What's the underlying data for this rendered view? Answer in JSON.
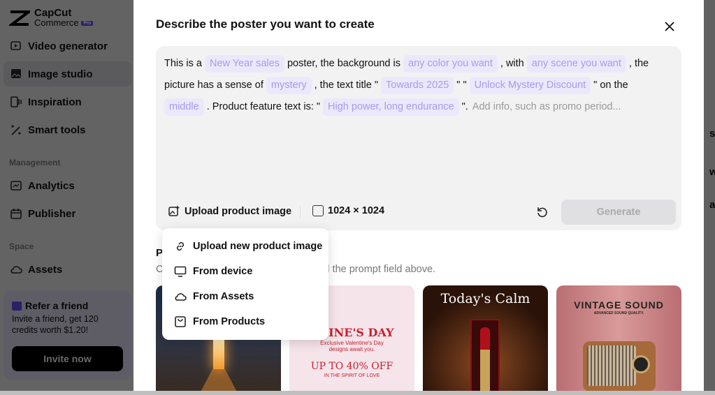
{
  "sidebar": {
    "logo": {
      "line1": "CapCut",
      "line2": "Commerce",
      "badge": "Pro"
    },
    "items": [
      {
        "label": "Video generator",
        "icon": "video-play-icon"
      },
      {
        "label": "Image studio",
        "icon": "image-icon",
        "active": true
      },
      {
        "label": "Inspiration",
        "icon": "inspiration-icon"
      },
      {
        "label": "Smart tools",
        "icon": "magic-wand-icon"
      }
    ],
    "management_label": "Management",
    "management": [
      {
        "label": "Analytics",
        "icon": "chart-icon"
      },
      {
        "label": "Publisher",
        "icon": "calendar-icon"
      }
    ],
    "space_label": "Space",
    "space": [
      {
        "label": "Assets",
        "icon": "cloud-icon"
      }
    ],
    "refer": {
      "title": "Refer a friend",
      "text": "Invite a friend, get 120 credits worth $1.20!",
      "button": "Invite now"
    }
  },
  "background": {
    "fragments": [
      "s",
      "ws",
      "a"
    ]
  },
  "modal": {
    "title": "Describe the poster you want to create",
    "prompt": {
      "t1": "This is a",
      "c1": "New Year sales",
      "t2": "poster, the background is",
      "c2": "any color you want",
      "t3": ", with",
      "c3": "any scene you want",
      "t4": ", the picture has a sense of",
      "c4": "mystery",
      "t5": ", the text title \"",
      "c5": "Towards 2025",
      "t6": "\" \"",
      "c6": "Unlock Mystery Discount",
      "t7": "\" on the",
      "c7": "middle",
      "t8": ". Product feature text is: \"",
      "c8": "High power, long endurance",
      "t9": "\".",
      "placeholder": "Add info, such as promo period..."
    },
    "upload_label": "Upload product image",
    "ratio": "1024 × 1024",
    "generate": "Generate",
    "section": {
      "title_fragment": "P",
      "desc_left": "C",
      "desc_right": "-fill the prompt field above."
    },
    "cards": [
      {
        "alt": "door"
      },
      {
        "heading": "NTINE'S DAY",
        "sub": "Exclusive Valentine's Day designs await you.",
        "offer": "UP TO 40% OFF",
        "tag": "IN THE SPIRIT OF LOVE"
      },
      {
        "heading": "Today's Calm"
      },
      {
        "heading": "VINTAGE SOUND",
        "sub": "ADVANCED SOUND QUALITY."
      }
    ]
  },
  "menu": {
    "items": [
      {
        "label": "Upload new product image",
        "icon": "link-icon"
      },
      {
        "label": "From device",
        "icon": "monitor-icon"
      },
      {
        "label": "From Assets",
        "icon": "cloud-icon"
      },
      {
        "label": "From Products",
        "icon": "bag-icon"
      }
    ]
  },
  "colors": {
    "chip_bg": "#ebe8fb",
    "chip_text": "#a89bf0",
    "accent": "#5b4bdb"
  }
}
